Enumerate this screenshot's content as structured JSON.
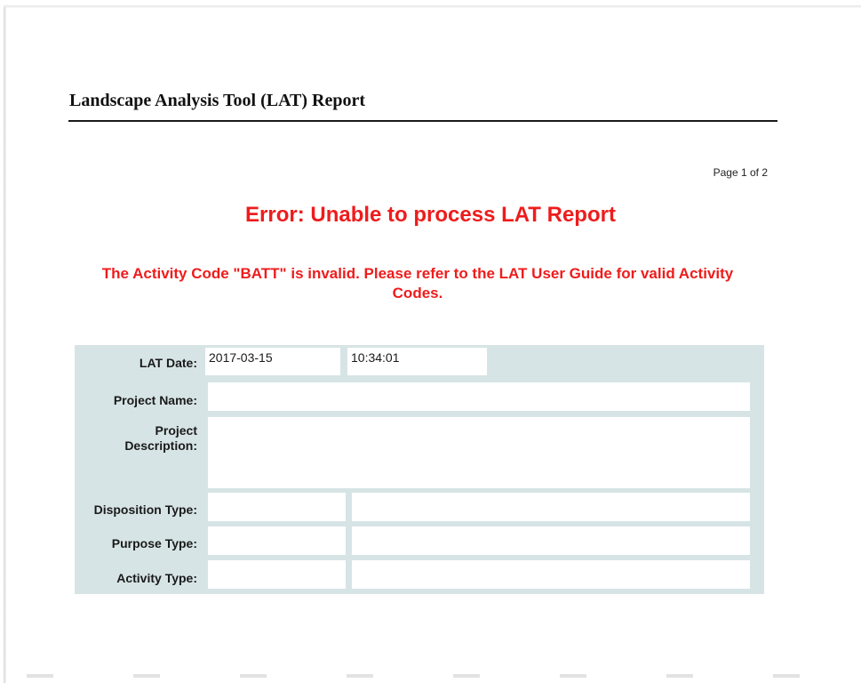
{
  "report": {
    "title": "Landscape Analysis Tool (LAT) Report",
    "page_indicator": "Page 1 of 2"
  },
  "error": {
    "heading": "Error: Unable to process LAT Report",
    "message": "The Activity Code \"BATT\" is invalid. Please refer to the LAT User Guide for valid Activity Codes."
  },
  "form": {
    "lat_date_label": "LAT Date:",
    "lat_date_value": "2017-03-15",
    "lat_time_value": "10:34:01",
    "project_name_label": "Project Name:",
    "project_name_value": "",
    "project_description_label_line1": "Project",
    "project_description_label_line2": "Description:",
    "project_description_value": "",
    "disposition_type_label": "Disposition Type:",
    "disposition_type_code": "",
    "disposition_type_desc": "",
    "purpose_type_label": "Purpose Type:",
    "purpose_type_code": "",
    "purpose_type_desc": "",
    "activity_type_label": "Activity Type:",
    "activity_type_code": "",
    "activity_type_desc": ""
  },
  "colors": {
    "error_red": "#ee1c1c",
    "panel_background": "#d7e4e6"
  }
}
